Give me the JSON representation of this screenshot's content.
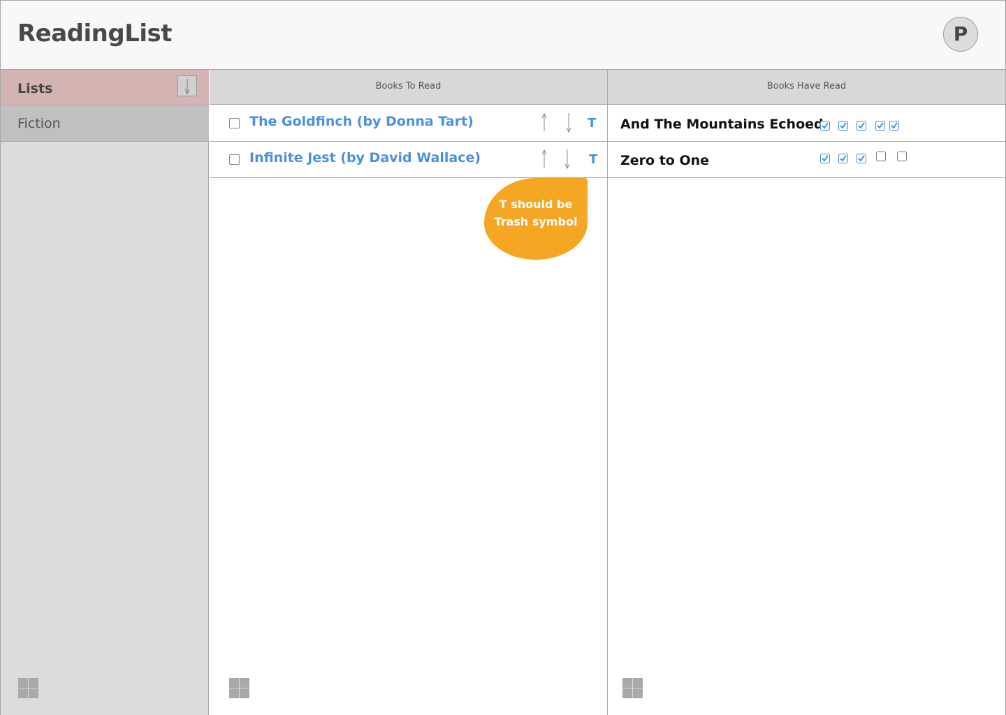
{
  "app": {
    "title": "ReadingList",
    "profile_initial": "P"
  },
  "sidebar": {
    "title": "Lists",
    "items": [
      {
        "label": "Fiction"
      }
    ]
  },
  "to_read": {
    "header": "Books To Read",
    "items": [
      {
        "title": "The Goldfinch (by Donna Tart)",
        "delete_label": "T",
        "checked": false
      },
      {
        "title": "Infinite Jest (by David Wallace)",
        "delete_label": "T",
        "checked": false
      }
    ]
  },
  "have_read": {
    "header": "Books Have Read",
    "items": [
      {
        "title": "And The Mountains Echoed",
        "rating": 5,
        "max_rating": 5
      },
      {
        "title": "Zero to One",
        "rating": 3,
        "max_rating": 5
      }
    ]
  },
  "annotation": {
    "line1": "T should be",
    "line2": "Trash symbol",
    "color": "#f5a623"
  },
  "colors": {
    "accent": "#4a90e2",
    "sidebar_header": "#d4b3b3",
    "selected_item": "#c0c0c0"
  }
}
